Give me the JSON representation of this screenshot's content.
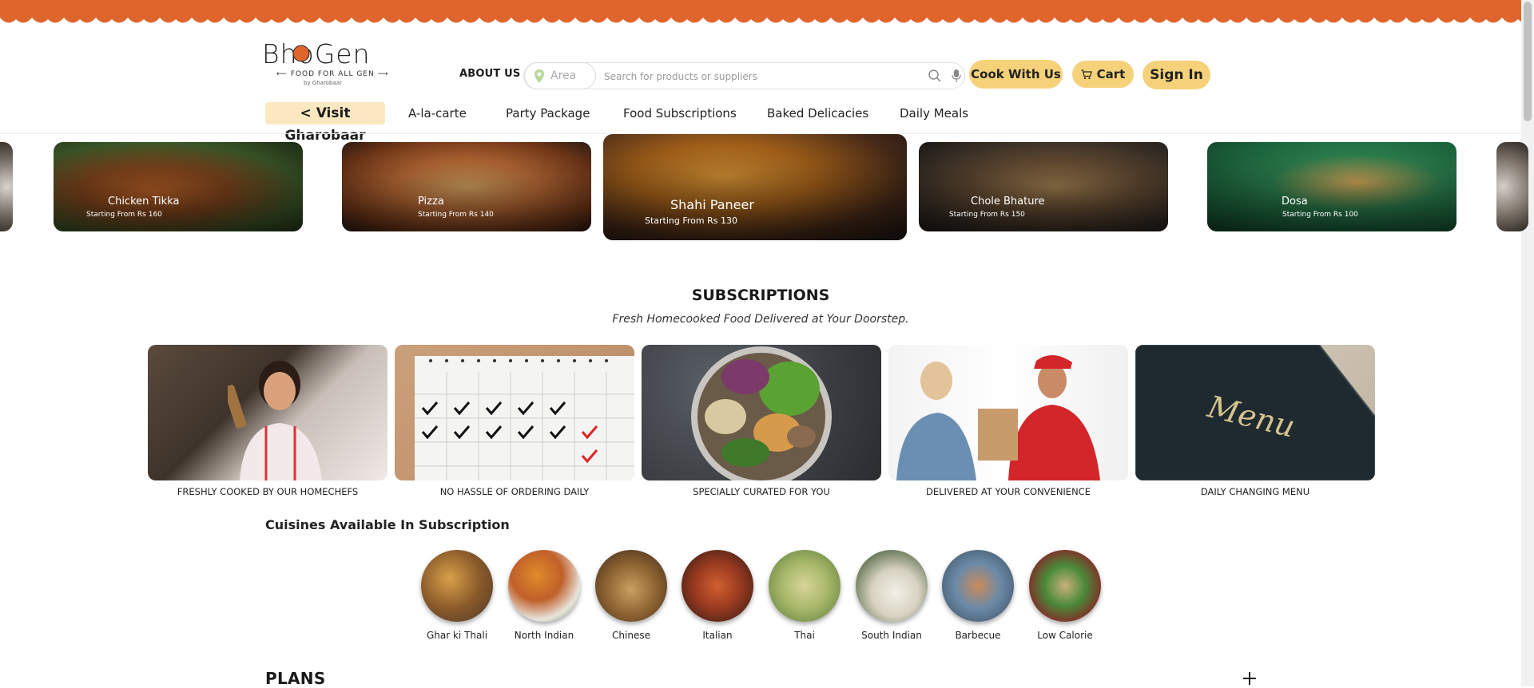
{
  "colors": {
    "brand_orange": "#e0652c",
    "pill_yellow": "#f5d17a",
    "visit_bg": "#fbe8c1"
  },
  "logo": {
    "word": "BhoGen",
    "tagline": "FOOD FOR ALL GEN",
    "by": "by Gharobaar"
  },
  "header": {
    "about": "ABOUT US",
    "area_placeholder": "Area",
    "search_placeholder": "Search for products or suppliers",
    "cook_button": "Cook With Us",
    "cart_button": "Cart",
    "signin_button": "Sign In"
  },
  "nav": {
    "visit": "< Visit Gharobaar",
    "items": [
      "A-la-carte",
      "Party Package",
      "Food Subscriptions",
      "Baked Delicacies",
      "Daily Meals"
    ]
  },
  "carousel": [
    {
      "name": "Chicken Tikka",
      "price": "Starting From Rs 160"
    },
    {
      "name": "Pizza",
      "price": "Starting From Rs 140"
    },
    {
      "name": "Shahi Paneer",
      "price": "Starting From Rs 130"
    },
    {
      "name": "Chole Bhature",
      "price": "Starting From Rs 150"
    },
    {
      "name": "Dosa",
      "price": "Starting From Rs 100"
    }
  ],
  "subscriptions": {
    "title": "SUBSCRIPTIONS",
    "tagline": "Fresh Homecooked Food Delivered at Your Doorstep.",
    "features": [
      "FRESHLY COOKED BY OUR HOMECHEFS",
      "NO HASSLE OF ORDERING DAILY",
      "SPECIALLY CURATED FOR YOU",
      "DELIVERED AT YOUR CONVENIENCE",
      "DAILY CHANGING MENU"
    ],
    "menu_image_text": "Menu"
  },
  "cuisines": {
    "title": "Cuisines Available In Subscription",
    "items": [
      "Ghar ki Thali",
      "North Indian",
      "Chinese",
      "Italian",
      "Thai",
      "South Indian",
      "Barbecue",
      "Low Calorie"
    ]
  },
  "plans": {
    "title": "PLANS"
  }
}
